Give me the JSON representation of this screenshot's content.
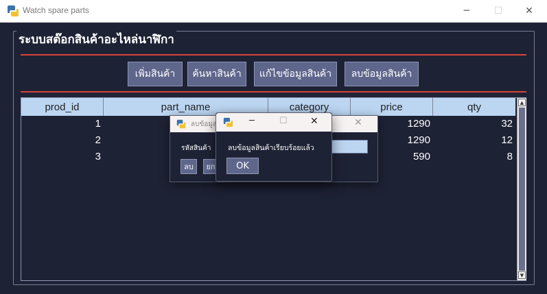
{
  "window": {
    "title": "Watch spare parts",
    "controls": {
      "minimize": "─",
      "maximize": "☐",
      "close": "✕"
    }
  },
  "app": {
    "heading": "ระบบสต๊อกสินค้าอะไหล่นาฬิกา",
    "buttons": [
      "เพิ่มสินค้า",
      "ค้นหาสินค้า",
      "แก้ไขข้อมูลสินค้า",
      "ลบข้อมูลสินค้า"
    ]
  },
  "table": {
    "columns": [
      "prod_id",
      "part_name",
      "category",
      "price",
      "qty"
    ],
    "rows": [
      {
        "prod_id": "1",
        "price": "1290",
        "qty": "32"
      },
      {
        "prod_id": "2",
        "price": "1290",
        "qty": "12"
      },
      {
        "prod_id": "3",
        "price": "590",
        "qty": "8"
      }
    ]
  },
  "delete_dialog": {
    "title": "ลบข้อมูล",
    "label": "รหัสสินค้า",
    "delete_button": "ลบ",
    "cancel_button": "ยก"
  },
  "message_dialog": {
    "message": "ลบข้อมูลสินค้าเรียบร้อยแล้ว",
    "ok_button": "OK"
  },
  "colors": {
    "background": "#1e2235",
    "accent_line": "#d8453a",
    "button": "#5e668c",
    "table_header": "#bcd6f2"
  },
  "icons": {
    "app_logo": "python-logo-icon",
    "scroll_up": "scroll-up-arrow-icon",
    "scroll_down": "scroll-down-arrow-icon"
  }
}
